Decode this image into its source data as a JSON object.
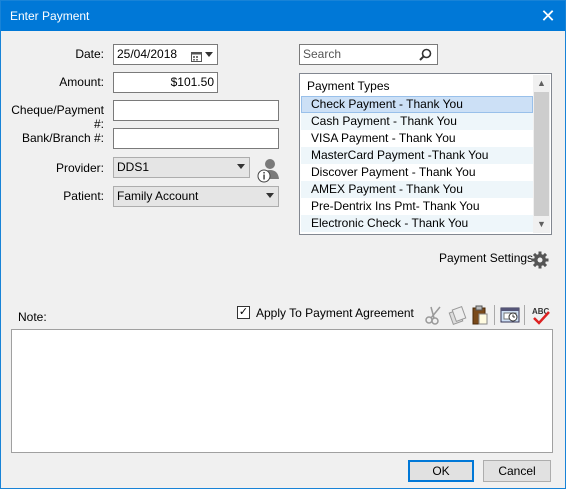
{
  "window": {
    "title": "Enter Payment",
    "close_glyph": "✕"
  },
  "form": {
    "date_label": "Date:",
    "date_value": "25/04/2018",
    "amount_label": "Amount:",
    "amount_value": "$101.50",
    "cheque_label": "Cheque/Payment #:",
    "cheque_value": "",
    "bank_label": "Bank/Branch #:",
    "bank_value": "",
    "provider_label": "Provider:",
    "provider_value": "DDS1",
    "patient_label": "Patient:",
    "patient_value": "Family Account"
  },
  "search": {
    "placeholder": "Search"
  },
  "payment_types": {
    "header": "Payment Types",
    "selected_index": 0,
    "items": [
      "Check Payment - Thank You",
      "Cash Payment - Thank You",
      "VISA Payment - Thank You",
      "MasterCard Payment -Thank You",
      "Discover Payment - Thank You",
      "AMEX Payment - Thank You",
      "Pre-Dentrix Ins Pmt- Thank You",
      "Electronic Check - Thank You"
    ]
  },
  "settings": {
    "label": "Payment Settings"
  },
  "note": {
    "label": "Note:",
    "value": "",
    "apply_agreement_label": "Apply To Payment Agreement",
    "apply_agreement_checked": true
  },
  "toolbar_icons": [
    "cut-icon",
    "copy-icon",
    "paste-icon",
    "date-stamp-icon",
    "spell-check-icon"
  ],
  "buttons": {
    "ok": "OK",
    "cancel": "Cancel"
  },
  "colors": {
    "titlebar": "#0078d7",
    "selection": "#cce0f6",
    "accent_border": "#0078d7"
  }
}
